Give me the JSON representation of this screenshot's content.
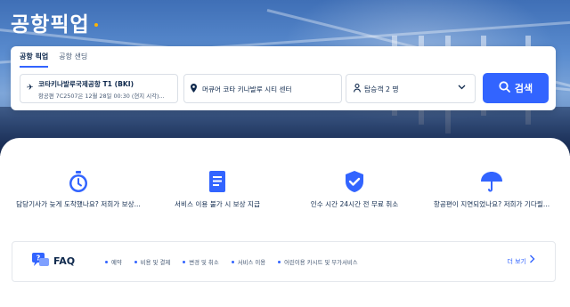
{
  "page": {
    "title": "공항픽업"
  },
  "tabs": [
    {
      "label": "공항 픽업",
      "active": true
    },
    {
      "label": "공항 샌딩",
      "active": false
    }
  ],
  "search": {
    "from": {
      "icon": "airplane-icon",
      "main": "코타키나발루국제공항 T1 (BKI)",
      "sub": "항공편 7C2507은 12월 28일 00:30 (현지 시각)..."
    },
    "to": {
      "icon": "map-pin-icon",
      "main": "머큐어 코타 키나발루 시티 센터"
    },
    "passengers": {
      "icon": "person-icon",
      "main": "탑승객  2 명"
    },
    "button_label": "검색"
  },
  "features": [
    {
      "icon": "stopwatch-icon",
      "label": "담당기사가 늦게 도착했나요? 저희가 보상..."
    },
    {
      "icon": "document-icon",
      "label": "서비스 이용 불가 시 보상 지급"
    },
    {
      "icon": "shield-check-icon",
      "label": "인수 시간 24시간 전 무료 취소"
    },
    {
      "icon": "umbrella-icon",
      "label": "항공편이 지연되었나요? 저희가 기다릴..."
    }
  ],
  "faq": {
    "title": "FAQ",
    "links": [
      "예약",
      "비용 및 결제",
      "변경 및 취소",
      "서비스 이용",
      "어린이용 카시트 및 부가서비스"
    ],
    "more": "더 보기"
  },
  "colors": {
    "accent": "#3264ff",
    "text": "#0f294d",
    "dot": "#ffb400"
  }
}
